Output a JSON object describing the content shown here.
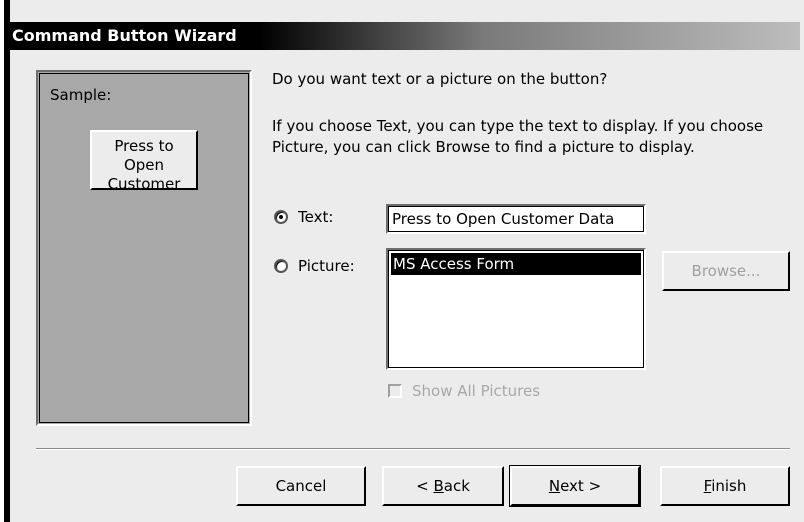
{
  "window": {
    "title": "Command Button Wizard"
  },
  "sample": {
    "label": "Sample:",
    "button_text": "Press to Open Customer Data"
  },
  "question": "Do you want text or a picture on the button?",
  "instructions": "If you choose Text, you can type the text to display.  If you choose Picture, you can click Browse to find a picture to display.",
  "options": {
    "text_label": "Text:",
    "text_value": "Press to Open Customer Data",
    "text_selected": true,
    "picture_label": "Picture:",
    "picture_list": [
      "MS Access Form"
    ],
    "picture_selected_item": "MS Access Form",
    "browse_label": "Browse...",
    "show_all_label": "Show All Pictures"
  },
  "buttons": {
    "cancel": "Cancel",
    "back_prefix": "< ",
    "back_accel": "B",
    "back_rest": "ack",
    "next_accel": "N",
    "next_rest": "ext >",
    "finish_accel": "F",
    "finish_rest": "inish"
  }
}
